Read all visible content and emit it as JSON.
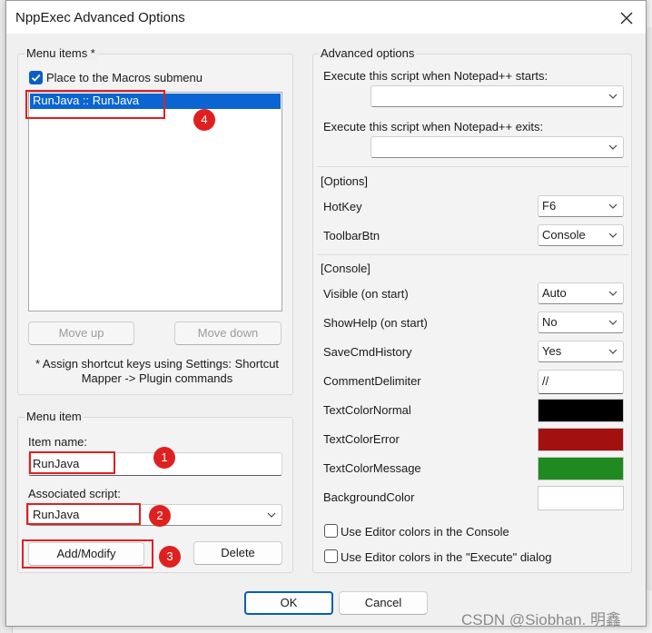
{
  "dialog": {
    "title": "NppExec Advanced Options",
    "close_glyph": "✕"
  },
  "menu_items": {
    "legend": "Menu items *",
    "place_macros_label": "Place to the Macros submenu",
    "place_macros_checked": true,
    "list": [
      "RunJava :: RunJava"
    ],
    "move_up": "Move up",
    "move_down": "Move down",
    "hint": "* Assign shortcut keys using Settings:  Shortcut Mapper -> Plugin commands"
  },
  "menu_item": {
    "legend": "Menu item",
    "item_name_label": "Item name:",
    "item_name_value": "RunJava",
    "script_label": "Associated script:",
    "script_value": "RunJava",
    "add_modify": "Add/Modify",
    "delete": "Delete"
  },
  "advanced": {
    "legend": "Advanced options",
    "start_label": "Execute this script when Notepad++ starts:",
    "start_value": "",
    "exit_label": "Execute this script when Notepad++ exits:",
    "exit_value": "",
    "options_header": "[Options]",
    "hotkey_label": "HotKey",
    "hotkey_value": "F6",
    "toolbarbtn_label": "ToolbarBtn",
    "toolbarbtn_value": "Console",
    "console_header": "[Console]",
    "visible_label": "Visible (on start)",
    "visible_value": "Auto",
    "showhelp_label": "ShowHelp (on start)",
    "showhelp_value": "No",
    "savecmd_label": "SaveCmdHistory",
    "savecmd_value": "Yes",
    "commentdelim_label": "CommentDelimiter",
    "commentdelim_value": "//",
    "textcolornormal_label": "TextColorNormal",
    "textcolorerror_label": "TextColorError",
    "textcolormessage_label": "TextColorMessage",
    "background_label": "BackgroundColor",
    "use_editor_console": "Use Editor colors in the Console",
    "use_editor_execute": "Use Editor colors in the \"Execute\" dialog"
  },
  "colors": {
    "text_normal": "#000000",
    "text_error": "#a31010",
    "text_message": "#1f8a1f",
    "background": "#ffffff",
    "annotation_red": "#e02020"
  },
  "annotations": {
    "one": "1",
    "two": "2",
    "three": "3",
    "four": "4"
  },
  "footer": {
    "ok": "OK",
    "cancel": "Cancel"
  },
  "watermark": "CSDN @Siobhan. 明鑫"
}
